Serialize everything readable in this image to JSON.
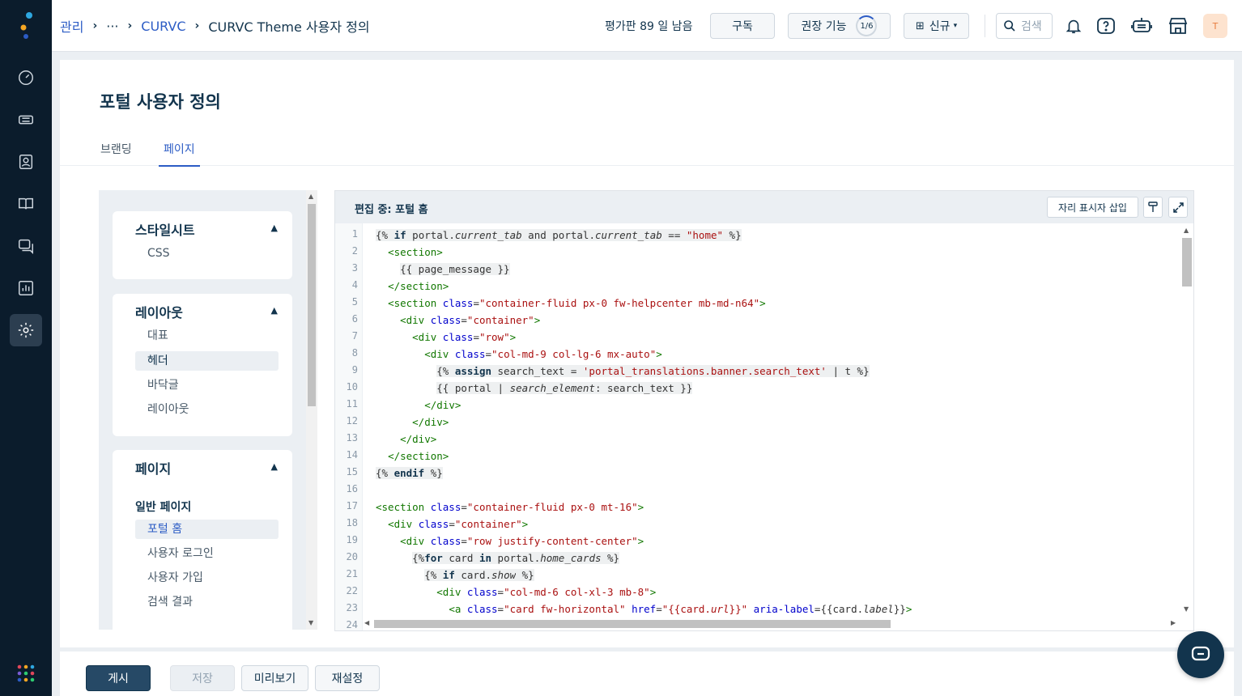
{
  "breadcrumb": {
    "admin": "관리",
    "ellipsis": "···",
    "curvc": "CURVC",
    "current": "CURVC Theme 사용자 정의"
  },
  "header": {
    "trial_text": "평가판 89 일 남음",
    "subscribe": "구독",
    "recommended": "권장 기능",
    "recommended_progress": "1/6",
    "new": "신규",
    "search_placeholder": "검색",
    "avatar_initial": "T"
  },
  "page": {
    "title": "포털 사용자 정의",
    "tabs": [
      "브랜딩",
      "페이지"
    ]
  },
  "tree": {
    "stylesheet": {
      "title": "스타일시트",
      "items": [
        "CSS"
      ]
    },
    "layout": {
      "title": "레이아웃",
      "items": [
        "대표",
        "헤더",
        "바닥글",
        "레이아웃"
      ]
    },
    "pages": {
      "title": "페이지",
      "subhead": "일반 페이지",
      "items": [
        "포털 홈",
        "사용자 로그인",
        "사용자 가입",
        "검색 결과"
      ]
    }
  },
  "editor": {
    "title": "편집 중: 포털 홈",
    "insert_placeholder": "자리 표시자 삽입",
    "line_numbers": [
      "1",
      "2",
      "3",
      "4",
      "5",
      "6",
      "7",
      "8",
      "9",
      "10",
      "11",
      "12",
      "13",
      "14",
      "15",
      "16",
      "17",
      "18",
      "19",
      "20",
      "21",
      "22",
      "23",
      "24"
    ],
    "lines": [
      [
        [
          "lq",
          "{% "
        ],
        [
          "lq kw",
          "if"
        ],
        [
          "lq",
          " portal."
        ],
        [
          "lq it",
          "current_tab"
        ],
        [
          "lq",
          " and portal."
        ],
        [
          "lq it",
          "current_tab"
        ],
        [
          "lq",
          " == "
        ],
        [
          "lq st",
          "\"home\""
        ],
        [
          "lq",
          " %}"
        ]
      ],
      [
        [
          "",
          "  "
        ],
        [
          "tg",
          "<section>"
        ]
      ],
      [
        [
          "",
          "    "
        ],
        [
          "lq",
          "{{ page_message }}"
        ]
      ],
      [
        [
          "",
          "  "
        ],
        [
          "tg",
          "</section>"
        ]
      ],
      [
        [
          "",
          "  "
        ],
        [
          "tg",
          "<section "
        ],
        [
          "at",
          "class"
        ],
        [
          "",
          "="
        ],
        [
          "st",
          "\"container-fluid px-0 fw-helpcenter mb-md-n64\""
        ],
        [
          "tg",
          ">"
        ]
      ],
      [
        [
          "",
          "    "
        ],
        [
          "tg",
          "<div "
        ],
        [
          "at",
          "class"
        ],
        [
          "",
          "="
        ],
        [
          "st",
          "\"container\""
        ],
        [
          "tg",
          ">"
        ]
      ],
      [
        [
          "",
          "      "
        ],
        [
          "tg",
          "<div "
        ],
        [
          "at",
          "class"
        ],
        [
          "",
          "="
        ],
        [
          "st",
          "\"row\""
        ],
        [
          "tg",
          ">"
        ]
      ],
      [
        [
          "",
          "        "
        ],
        [
          "tg",
          "<div "
        ],
        [
          "at",
          "class"
        ],
        [
          "",
          "="
        ],
        [
          "st",
          "\"col-md-9 col-lg-6 mx-auto\""
        ],
        [
          "tg",
          ">"
        ]
      ],
      [
        [
          "",
          "          "
        ],
        [
          "lq",
          "{% "
        ],
        [
          "lq kw",
          "assign"
        ],
        [
          "lq",
          " search_text = "
        ],
        [
          "lq st",
          "'portal_translations.banner.search_text'"
        ],
        [
          "lq",
          " | t %}"
        ]
      ],
      [
        [
          "",
          "          "
        ],
        [
          "lq",
          "{{ portal | "
        ],
        [
          "lq it",
          "search_element"
        ],
        [
          "lq",
          ": search_text }}"
        ]
      ],
      [
        [
          "",
          "        "
        ],
        [
          "tg",
          "</div>"
        ]
      ],
      [
        [
          "",
          "      "
        ],
        [
          "tg",
          "</div>"
        ]
      ],
      [
        [
          "",
          "    "
        ],
        [
          "tg",
          "</div>"
        ]
      ],
      [
        [
          "",
          "  "
        ],
        [
          "tg",
          "</section>"
        ]
      ],
      [
        [
          "lq",
          "{% "
        ],
        [
          "lq kw",
          "endif"
        ],
        [
          "lq",
          " %}"
        ]
      ],
      [],
      [
        [
          "tg",
          "<section "
        ],
        [
          "at",
          "class"
        ],
        [
          "",
          "="
        ],
        [
          "st",
          "\"container-fluid px-0 mt-16\""
        ],
        [
          "tg",
          ">"
        ]
      ],
      [
        [
          "",
          "  "
        ],
        [
          "tg",
          "<div "
        ],
        [
          "at",
          "class"
        ],
        [
          "",
          "="
        ],
        [
          "st",
          "\"container\""
        ],
        [
          "tg",
          ">"
        ]
      ],
      [
        [
          "",
          "    "
        ],
        [
          "tg",
          "<div "
        ],
        [
          "at",
          "class"
        ],
        [
          "",
          "="
        ],
        [
          "st",
          "\"row justify-content-center\""
        ],
        [
          "tg",
          ">"
        ]
      ],
      [
        [
          "",
          "      "
        ],
        [
          "lq",
          "{%"
        ],
        [
          "lq kw",
          "for"
        ],
        [
          "lq",
          " card "
        ],
        [
          "lq kw",
          "in"
        ],
        [
          "lq",
          " portal."
        ],
        [
          "lq it",
          "home_cards"
        ],
        [
          "lq",
          " %}"
        ]
      ],
      [
        [
          "",
          "        "
        ],
        [
          "lq",
          "{% "
        ],
        [
          "lq kw",
          "if"
        ],
        [
          "lq",
          " card."
        ],
        [
          "lq it",
          "show"
        ],
        [
          "lq",
          " %}"
        ]
      ],
      [
        [
          "",
          "          "
        ],
        [
          "tg",
          "<div "
        ],
        [
          "at",
          "class"
        ],
        [
          "",
          "="
        ],
        [
          "st",
          "\"col-md-6 col-xl-3 mb-8\""
        ],
        [
          "tg",
          ">"
        ]
      ],
      [
        [
          "",
          "            "
        ],
        [
          "tg",
          "<a "
        ],
        [
          "at",
          "class"
        ],
        [
          "",
          "="
        ],
        [
          "st",
          "\"card fw-horizontal\""
        ],
        [
          "",
          " "
        ],
        [
          "at",
          "href"
        ],
        [
          "",
          "="
        ],
        [
          "st",
          "\"{{card."
        ],
        [
          "st it",
          "url"
        ],
        [
          "st",
          "}}\""
        ],
        [
          "",
          " "
        ],
        [
          "at",
          "aria-label"
        ],
        [
          "",
          "={{card."
        ],
        [
          "it",
          "label"
        ],
        [
          "",
          "}}"
        ],
        [
          "tg",
          ">"
        ]
      ],
      []
    ]
  },
  "footer": {
    "publish": "게시",
    "save": "저장",
    "preview": "미리보기",
    "reset": "재설정"
  }
}
